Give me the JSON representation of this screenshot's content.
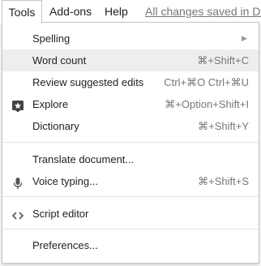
{
  "menubar": {
    "tools": "Tools",
    "addons": "Add-ons",
    "help": "Help",
    "saved": "All changes saved in Dr"
  },
  "menu": {
    "items": [
      {
        "label": "Spelling",
        "shortcut": "",
        "icon": "",
        "submenu": true
      },
      {
        "label": "Word count",
        "shortcut": "⌘+Shift+C",
        "icon": "",
        "submenu": false,
        "highlighted": true
      },
      {
        "label": "Review suggested edits",
        "shortcut": "Ctrl+⌘O Ctrl+⌘U",
        "icon": "",
        "submenu": false
      },
      {
        "label": "Explore",
        "shortcut": "⌘+Option+Shift+I",
        "icon": "explore-icon",
        "submenu": false
      },
      {
        "label": "Dictionary",
        "shortcut": "⌘+Shift+Y",
        "icon": "",
        "submenu": false
      },
      {
        "label": "Translate document...",
        "shortcut": "",
        "icon": "",
        "submenu": false
      },
      {
        "label": "Voice typing...",
        "shortcut": "⌘+Shift+S",
        "icon": "microphone-icon",
        "submenu": false
      },
      {
        "label": "Script editor",
        "shortcut": "",
        "icon": "code-icon",
        "submenu": false
      },
      {
        "label": "Preferences...",
        "shortcut": "",
        "icon": "",
        "submenu": false
      }
    ]
  }
}
